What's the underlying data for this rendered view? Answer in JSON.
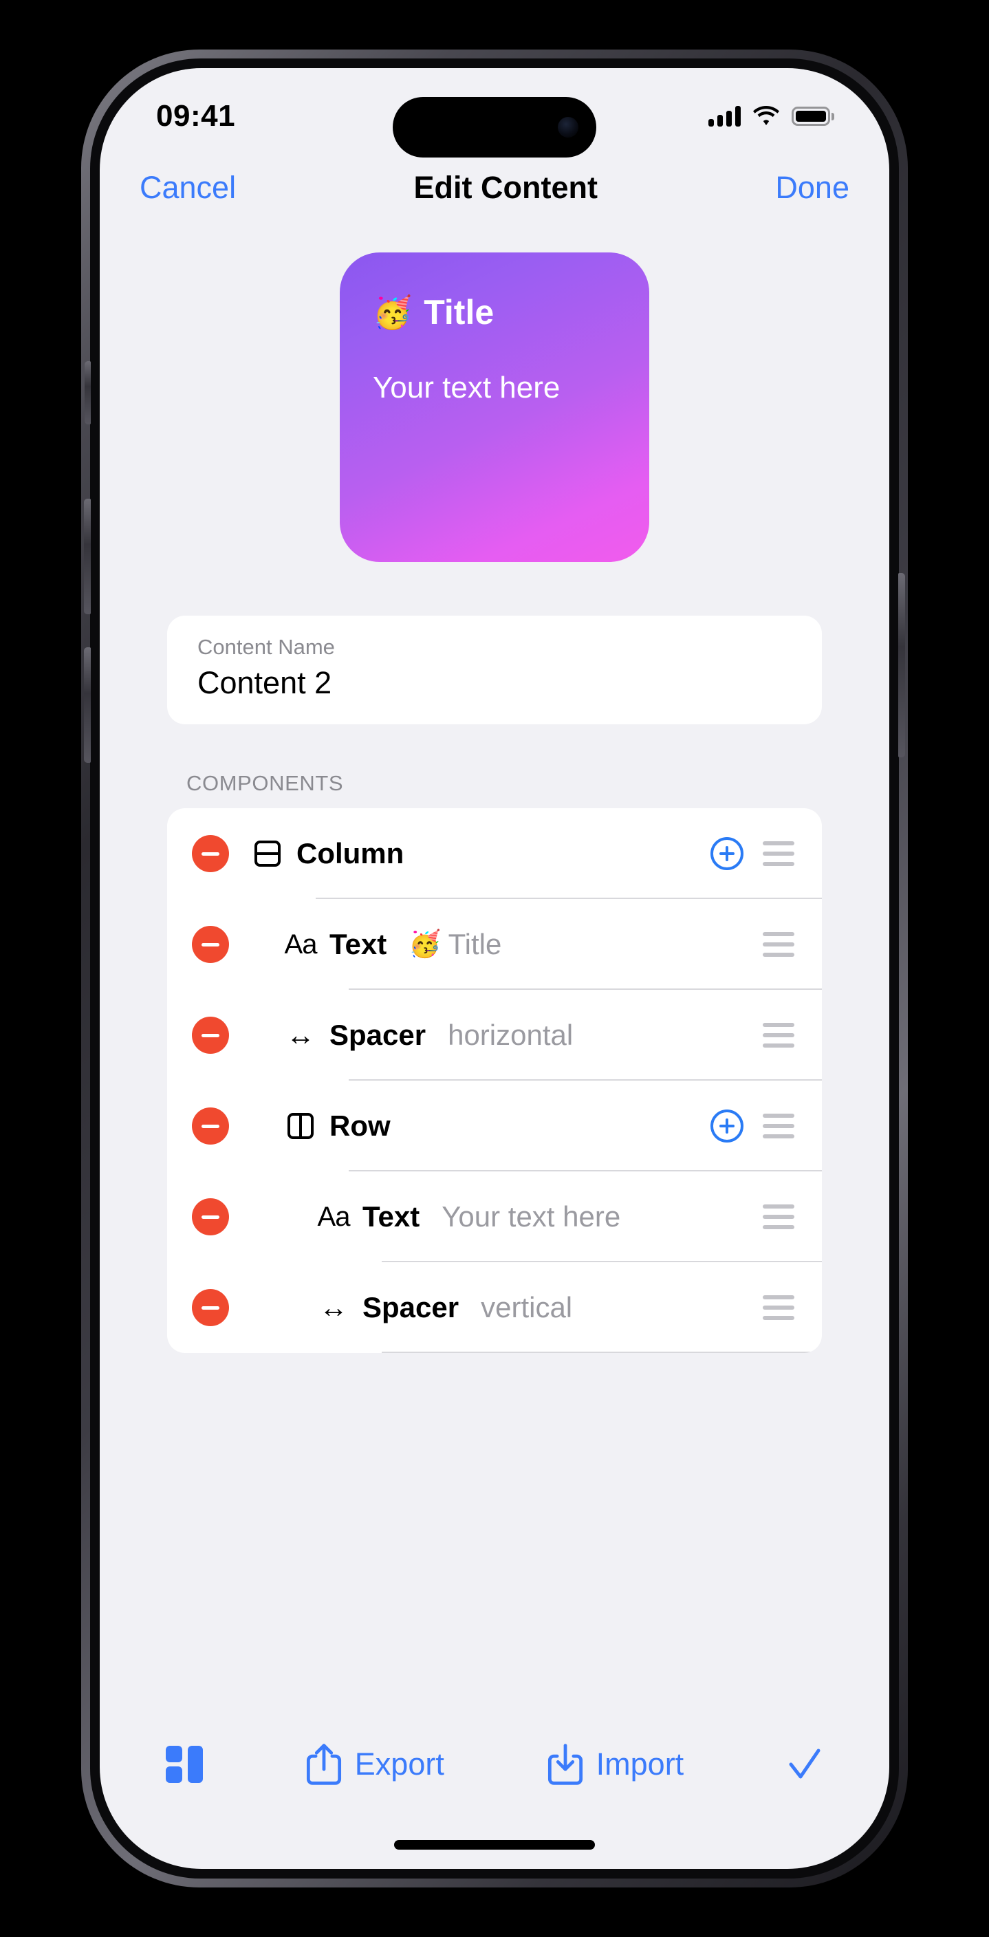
{
  "status_bar": {
    "time": "09:41",
    "cellular_icon": "signal-bars-icon",
    "wifi_icon": "wifi-icon",
    "battery_icon": "battery-full-icon"
  },
  "nav": {
    "cancel_label": "Cancel",
    "title": "Edit Content",
    "done_label": "Done"
  },
  "preview": {
    "emoji": "🥳",
    "title": "Title",
    "body": "Your text here",
    "gradient_start": "#8b57f0",
    "gradient_end": "#f15bec"
  },
  "name_field": {
    "label": "Content Name",
    "value": "Content 2"
  },
  "components": {
    "section_header": "COMPONENTS",
    "rows": [
      {
        "label": "Column",
        "value": "",
        "value_emoji": "",
        "icon": "column-split-icon",
        "indent": 0,
        "has_add": true
      },
      {
        "label": "Text",
        "value": "Title",
        "value_emoji": "🥳",
        "icon": "text-aa-icon",
        "indent": 1,
        "has_add": false
      },
      {
        "label": "Spacer",
        "value": "horizontal",
        "value_emoji": "",
        "icon": "arrows-horizontal-icon",
        "indent": 1,
        "has_add": false
      },
      {
        "label": "Row",
        "value": "",
        "value_emoji": "",
        "icon": "row-split-icon",
        "indent": 1,
        "has_add": true
      },
      {
        "label": "Text",
        "value": "Your text here",
        "value_emoji": "",
        "icon": "text-aa-icon",
        "indent": 2,
        "has_add": false
      },
      {
        "label": "Spacer",
        "value": "vertical",
        "value_emoji": "",
        "icon": "arrows-horizontal-icon",
        "indent": 2,
        "has_add": false
      }
    ],
    "remove_icon": "minus-circle-icon",
    "add_icon": "plus-circle-icon",
    "drag_icon": "drag-handle-icon"
  },
  "toolbar": {
    "layout_icon": "layout-grid-icon",
    "export_label": "Export",
    "export_icon": "share-up-icon",
    "import_label": "Import",
    "import_icon": "download-icon",
    "confirm_icon": "checkmark-icon"
  },
  "colors": {
    "accent_blue": "#3b7bfb",
    "destructive_red": "#f0492f",
    "background": "#f1f1f5",
    "card": "#ffffff",
    "secondary_text": "#8a8a90"
  }
}
